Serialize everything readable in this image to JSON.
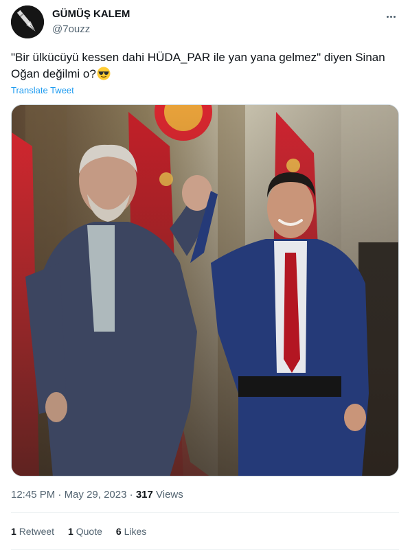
{
  "user": {
    "name": "GÜMÜŞ KALEM",
    "handle": "@7ouzz"
  },
  "tweet": {
    "text": "\"Bir ülkücüyü kessen dahi HÜDA_PAR ile yan yana gelmez\" diyen Sinan Oğan değilmi o?",
    "emoji": "smiling-face-with-sunglasses",
    "translate_label": "Translate Tweet"
  },
  "meta": {
    "time": "12:45 PM",
    "sep1": "·",
    "date": "May 29, 2023",
    "sep2": "·",
    "views_count": "317",
    "views_label": "Views"
  },
  "stats": {
    "retweets_count": "1",
    "retweets_label": "Retweet",
    "quotes_count": "1",
    "quotes_label": "Quote",
    "likes_count": "6",
    "likes_label": "Likes"
  },
  "colors": {
    "link": "#1d9bf0",
    "secondary_text": "#536471",
    "primary_text": "#0f1419",
    "divider": "#eff3f4",
    "flag_red": "#d8262f"
  }
}
